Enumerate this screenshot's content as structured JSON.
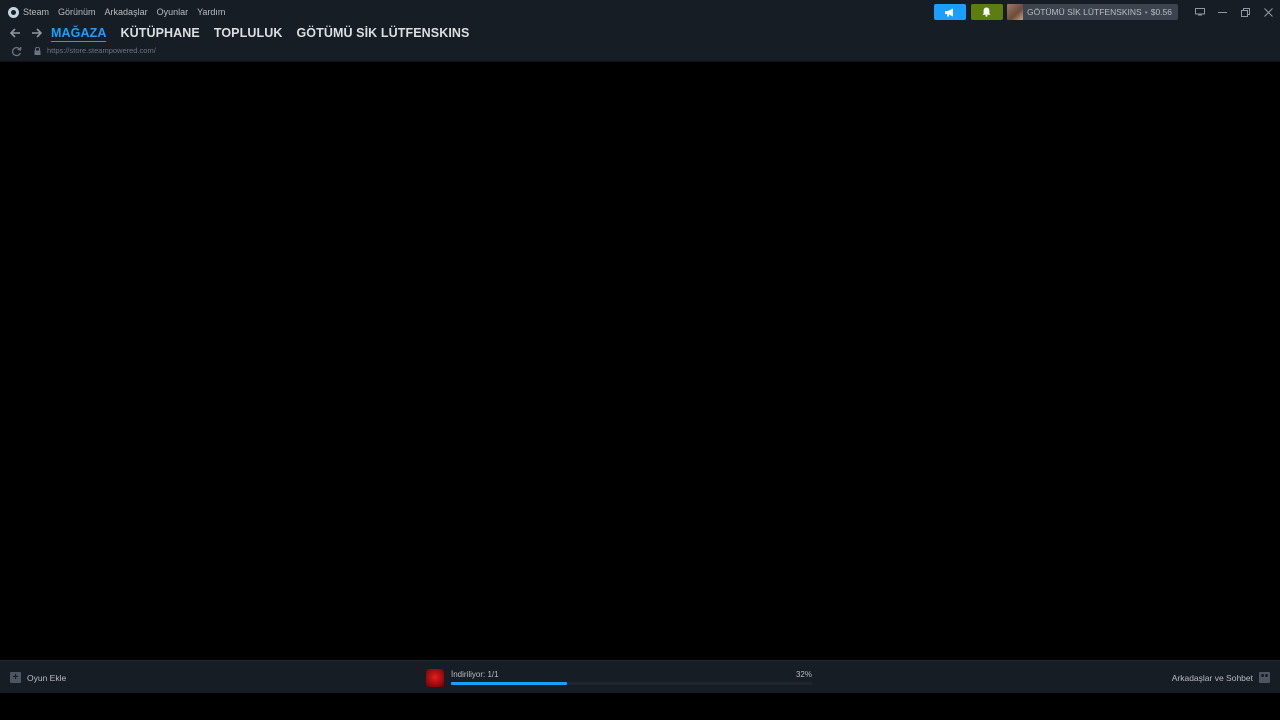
{
  "menu": {
    "items": [
      "Steam",
      "Görünüm",
      "Arkadaşlar",
      "Oyunlar",
      "Yardım"
    ]
  },
  "account": {
    "name": "GÖTÜMÜ SİK LÜTFENSKINS",
    "separator": "•",
    "balance": "$0.56"
  },
  "nav": {
    "tabs": [
      "MAĞAZA",
      "KÜTÜPHANE",
      "TOPLULUK",
      "GÖTÜMÜ SİK LÜTFENSKINS"
    ],
    "active_tab": "MAĞAZA"
  },
  "url_bar": {
    "url": "https://store.steampowered.com/"
  },
  "bottom_bar": {
    "add_game_label": "Oyun Ekle",
    "download_label": "İndiriliyor: 1/1",
    "download_progress_percent": 32,
    "download_progress_label": "32%",
    "friends_label": "Arkadaşlar ve Sohbet"
  },
  "colors": {
    "accent": "#1a9fff",
    "notification_green": "#5c7e10",
    "bar_background": "#171d25"
  },
  "icons": {
    "logo": "steam-logo-icon",
    "announce": "megaphone-icon",
    "notify": "bell-icon",
    "back": "arrow-left-icon",
    "forward": "arrow-right-icon",
    "reload": "reload-icon",
    "lock": "lock-icon",
    "add": "plus-icon",
    "friends": "friends-chat-icon"
  }
}
